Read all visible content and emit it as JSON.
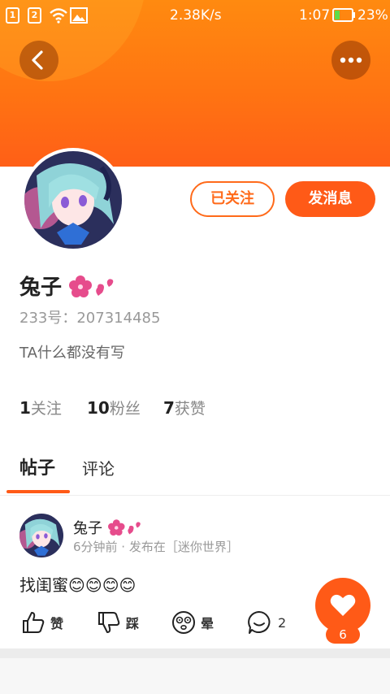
{
  "status_bar": {
    "sim1": "1",
    "sim2": "2",
    "network_speed": "2.38K/s",
    "time": "1:07",
    "battery": "23%"
  },
  "header": {
    "accent": "#ff6a14"
  },
  "profile": {
    "name": "兔子",
    "id_label": "233号：207314485",
    "bio": "TA什么都没有写",
    "follow_button": "已关注",
    "message_button": "发消息",
    "stats": {
      "following_count": "1",
      "following_label": "关注",
      "fans_count": "10",
      "fans_label": "粉丝",
      "likes_count": "7",
      "likes_label": "获赞"
    }
  },
  "tabs": [
    {
      "label": "帖子",
      "active": true
    },
    {
      "label": "评论",
      "active": false
    }
  ],
  "post": {
    "author": "兔子",
    "meta": "6分钟前 · 发布在［迷你世界］",
    "body": "找闺蜜😊😊😊😊",
    "actions": {
      "like": "赞",
      "dislike": "踩",
      "dizzy": "晕",
      "comments": "2"
    }
  },
  "fab": {
    "count": "6"
  }
}
